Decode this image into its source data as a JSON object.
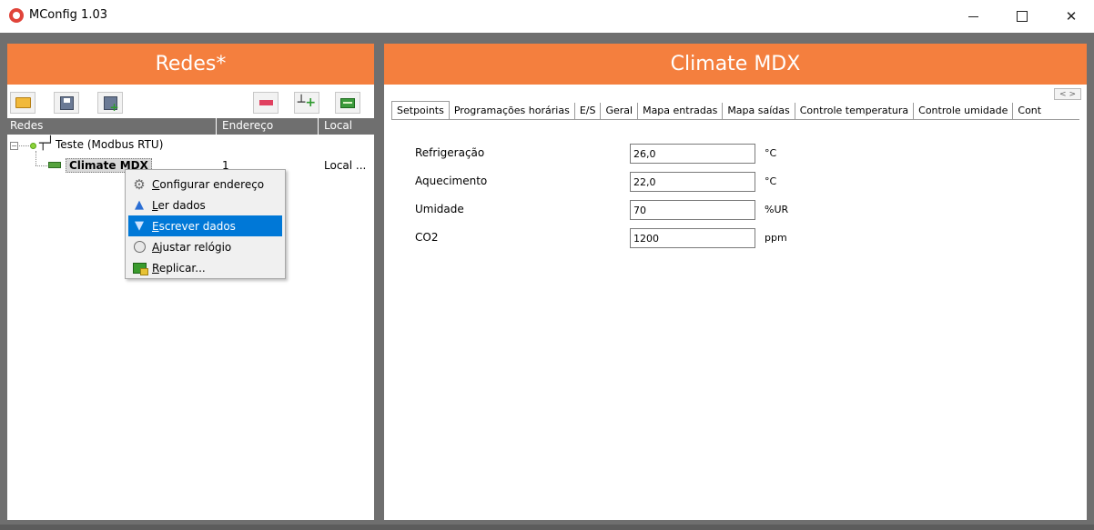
{
  "window": {
    "title": "MConfig 1.03",
    "minimize_icon": "minimize-icon",
    "maximize_icon": "maximize-icon",
    "close_glyph": "✕"
  },
  "left_panel": {
    "title": "Redes*",
    "toolbar": [
      {
        "name": "open-button",
        "icon": "folder-icon"
      },
      {
        "name": "save-button",
        "icon": "save-icon"
      },
      {
        "name": "save-as-button",
        "icon": "save-as-icon"
      },
      {
        "name": "remove-button",
        "icon": "remove-icon"
      },
      {
        "name": "add-network-button",
        "icon": "network-icon"
      },
      {
        "name": "add-device-button",
        "icon": "device-icon"
      }
    ],
    "columns": [
      "Redes",
      "Endereço",
      "Local"
    ],
    "tree": {
      "network": {
        "label": "Teste (Modbus RTU)",
        "expander": "⊟",
        "status_color": "#8cd33a"
      },
      "device": {
        "label": "Climate MDX",
        "address": "1",
        "local": "Local ..."
      }
    }
  },
  "context_menu": {
    "items": [
      {
        "pre": "",
        "accel": "C",
        "post": "onfigurar endereço",
        "icon": "gear-icon",
        "active": false
      },
      {
        "pre": "",
        "accel": "L",
        "post": "er dados",
        "icon": "arrow-up-icon",
        "active": false
      },
      {
        "pre": "",
        "accel": "E",
        "post": "screver dados",
        "icon": "arrow-down-icon",
        "active": true
      },
      {
        "pre": "",
        "accel": "A",
        "post": "justar relógio",
        "icon": "clock-icon",
        "active": false
      },
      {
        "pre": "",
        "accel": "R",
        "post": "eplicar...",
        "icon": "replicate-icon",
        "active": false
      }
    ]
  },
  "right_panel": {
    "title": "Climate MDX",
    "tabs": [
      "Setpoints",
      "Programações horárias",
      "E/S",
      "Geral",
      "Mapa entradas",
      "Mapa saídas",
      "Controle temperatura",
      "Controle umidade",
      "Cont"
    ],
    "active_tab": "Setpoints",
    "tab_scroll": {
      "left": "<",
      "right": ">"
    },
    "setpoints": [
      {
        "label": "Refrigeração",
        "value": "26,0",
        "unit": "°C"
      },
      {
        "label": "Aquecimento",
        "value": "22,0",
        "unit": "°C"
      },
      {
        "label": "Umidade",
        "value": "70",
        "unit": "%UR"
      },
      {
        "label": "CO2",
        "value": "1200",
        "unit": "ppm"
      }
    ]
  },
  "colors": {
    "header": "#f47f3e",
    "frame": "#6f6f6f",
    "menu_highlight": "#0078d7"
  }
}
